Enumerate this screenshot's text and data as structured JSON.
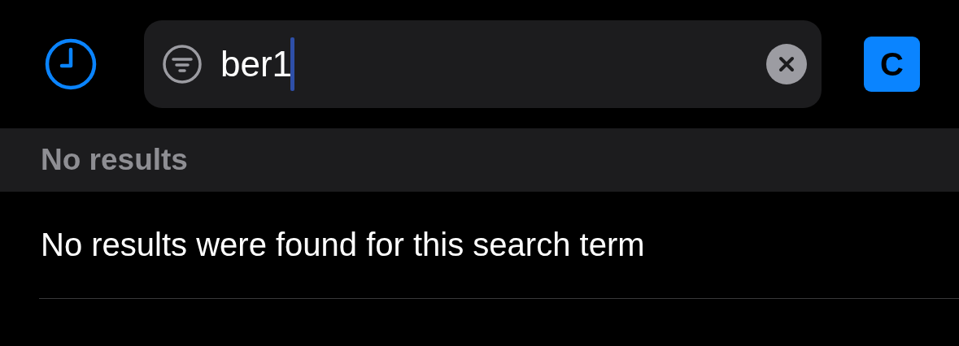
{
  "search": {
    "value": "ber1"
  },
  "badge": {
    "label": "C"
  },
  "section": {
    "title": "No results"
  },
  "message": "No results were found for this search term"
}
